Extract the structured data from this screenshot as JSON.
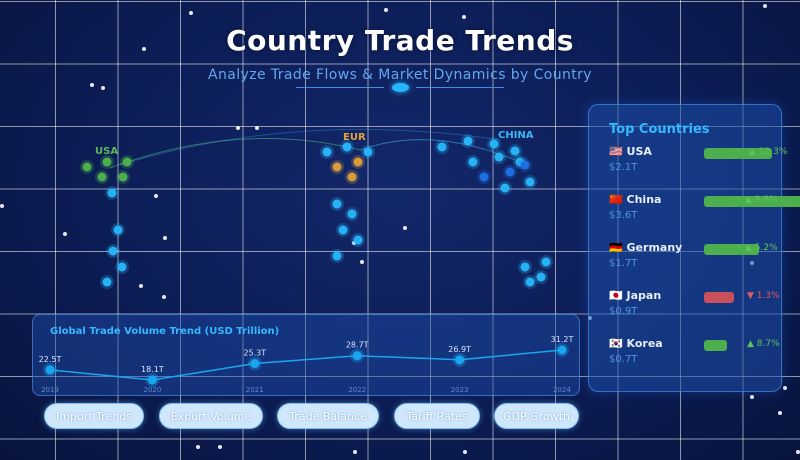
{
  "header": {
    "title": "Country Trade Trends",
    "subtitle": "Analyze Trade Flows & Market Dynamics by Country"
  },
  "map": {
    "regions": [
      {
        "label": "USA",
        "color": "#5cb85c"
      },
      {
        "label": "EUR",
        "color": "#e2a23a"
      },
      {
        "label": "CHINA",
        "color": "#3ab6f0"
      }
    ]
  },
  "top_countries": {
    "title": "Top Countries",
    "items": [
      {
        "flag": "🇺🇸",
        "name": "USA",
        "value": "$2.1T",
        "change": "▲ 12.3%",
        "direction": "up",
        "bar_color": "#4cae4c"
      },
      {
        "flag": "🇨🇳",
        "name": "China",
        "value": "$3.6T",
        "change": "▲ 9.8%",
        "direction": "up",
        "bar_color": "#4cae4c"
      },
      {
        "flag": "🇩🇪",
        "name": "Germany",
        "value": "$1.7T",
        "change": "▲ 5.2%",
        "direction": "up",
        "bar_color": "#4cae4c"
      },
      {
        "flag": "🇯🇵",
        "name": "Japan",
        "value": "$0.9T",
        "change": "▼ 1.3%",
        "direction": "down",
        "bar_color": "#c9505a"
      },
      {
        "flag": "🇰🇷",
        "name": "Korea",
        "value": "$0.7T",
        "change": "▲ 8.7%",
        "direction": "up",
        "bar_color": "#4cae4c"
      }
    ]
  },
  "chart_data": {
    "type": "line",
    "title": "Global Trade Volume Trend (USD Trillion)",
    "x": [
      "2019",
      "2020",
      "2021",
      "2022",
      "2023",
      "2024"
    ],
    "series": [
      {
        "values": [
          22.5,
          18.1,
          25.3,
          28.7,
          26.9,
          31.2
        ],
        "labels": [
          "22.5T",
          "18.1T",
          "25.3T",
          "28.7T",
          "26.9T",
          "31.2T"
        ]
      }
    ],
    "color": "#1aa6ee"
  },
  "buttons": [
    {
      "label": "Import Trends"
    },
    {
      "label": "Export Volume"
    },
    {
      "label": "Trade Balance"
    },
    {
      "label": "Tariff Rates"
    },
    {
      "label": "GDP Growth"
    }
  ]
}
